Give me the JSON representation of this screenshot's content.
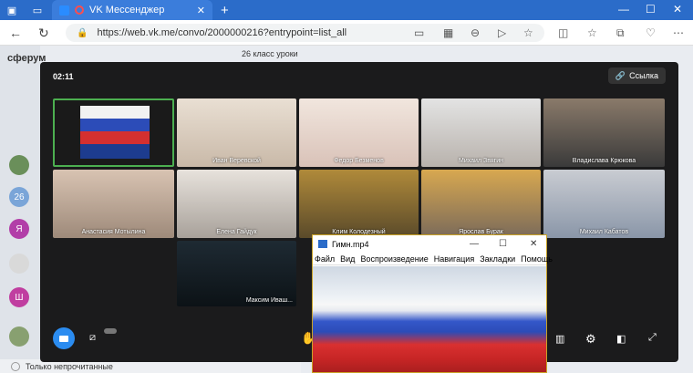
{
  "browser": {
    "tab_title": "VK Мессенджер",
    "url": "https://web.vk.me/convo/2000000216?entrypoint=list_all"
  },
  "vk": {
    "logo": "сферум",
    "chat_title": "26 класс уроки",
    "filter_label": "Только непрочитанные",
    "side_avatars": [
      "",
      "26",
      "Я",
      "",
      "Ш",
      ""
    ]
  },
  "call": {
    "timer": "02:11",
    "link_label": "Ссылка",
    "participants": [
      {
        "name": ""
      },
      {
        "name": "Иван Веревской"
      },
      {
        "name": "Федор Безменов"
      },
      {
        "name": "Михаил Звягин"
      },
      {
        "name": "Владислава Крюкова"
      },
      {
        "name": "Анастасия Мотылина"
      },
      {
        "name": "Елена Гайдук"
      },
      {
        "name": "Клим Колодезный"
      },
      {
        "name": "Ярослав Бурак"
      },
      {
        "name": "Михаил Кабатов"
      },
      {
        "name": "Максим Иваш..."
      }
    ]
  },
  "player": {
    "title": "Гимн.mp4",
    "menu": [
      "Файл",
      "Вид",
      "Воспроизведение",
      "Навигация",
      "Закладки",
      "Помощь"
    ]
  },
  "colors": {
    "accent": "#2b8cf0",
    "browser_bar": "#2b6cc9",
    "call_bg": "#1b1b1c"
  }
}
